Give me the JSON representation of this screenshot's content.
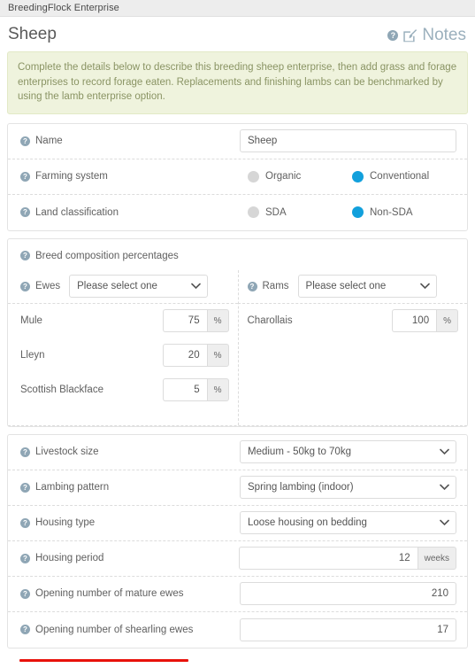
{
  "topbar": {
    "breadcrumb": "BreedingFlock Enterprise"
  },
  "header": {
    "title": "Sheep",
    "notes_label": "Notes",
    "help_icon": "help-circle-icon",
    "notes_icon": "edit-pencil-square-icon"
  },
  "alert": {
    "text": "Complete the details below to describe this breeding sheep enterprise, then add grass and forage enterprises to record forage eaten. Replacements and finishing lambs can be benchmarked by using the lamb enterprise option.",
    "bg_color": "#eff3dd",
    "text_color": "#8a9464"
  },
  "colors": {
    "accent_blue": "#12a0dc",
    "radio_off": "#d6d6d6",
    "help_icon": "#8fa6b5",
    "annotation_red": "#e8120b"
  },
  "form": {
    "name": {
      "label": "Name",
      "value": "Sheep",
      "placeholder": ""
    },
    "farming_system": {
      "label": "Farming system",
      "options": [
        "Organic",
        "Conventional"
      ],
      "selected": "Conventional"
    },
    "land_classification": {
      "label": "Land classification",
      "options": [
        "SDA",
        "Non-SDA"
      ],
      "selected": "Non-SDA"
    },
    "breed_composition": {
      "heading": "Breed composition percentages",
      "ewes": {
        "label": "Ewes",
        "select_value": "Please select one",
        "breeds": [
          {
            "name": "Mule",
            "value": "75",
            "unit": "%"
          },
          {
            "name": "Lleyn",
            "value": "20",
            "unit": "%"
          },
          {
            "name": "Scottish Blackface",
            "value": "5",
            "unit": "%"
          }
        ]
      },
      "rams": {
        "label": "Rams",
        "select_value": "Please select one",
        "breeds": [
          {
            "name": "Charollais",
            "value": "100",
            "unit": "%"
          }
        ]
      }
    },
    "livestock_size": {
      "label": "Livestock size",
      "value": "Medium - 50kg to 70kg"
    },
    "lambing_pattern": {
      "label": "Lambing pattern",
      "value": "Spring lambing (indoor)"
    },
    "housing_type": {
      "label": "Housing type",
      "value": "Loose housing on bedding"
    },
    "housing_period": {
      "label": "Housing period",
      "value": "12",
      "unit": "weeks"
    },
    "opening_mature_ewes": {
      "label": "Opening number of mature ewes",
      "value": "210"
    },
    "opening_shearling_ewes": {
      "label": "Opening number of shearling ewes",
      "value": "17"
    }
  }
}
